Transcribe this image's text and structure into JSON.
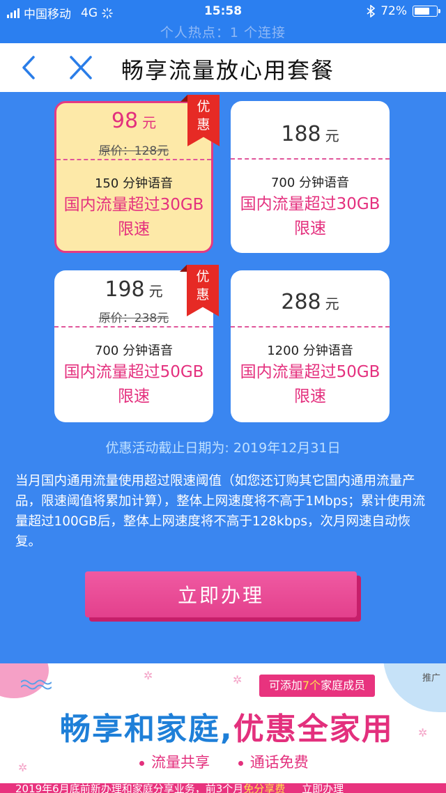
{
  "status_bar": {
    "carrier": "中国移动",
    "network": "4G",
    "time": "15:58",
    "battery": "72%",
    "battery_level": 0.72,
    "hotspot": "个人热点：1 个连接"
  },
  "nav": {
    "back_icon": "chevron-left-icon",
    "close_icon": "close-icon",
    "title": "畅享流量放心用套餐"
  },
  "plans": [
    {
      "price": "98",
      "unit": "元",
      "original": "原价：128元",
      "minutes": "150 分钟语音",
      "data": "国内流量超过30GB",
      "limit": "限速",
      "badge": "优惠",
      "selected": true
    },
    {
      "price": "188",
      "unit": "元",
      "original": "",
      "minutes": "700 分钟语音",
      "data": "国内流量超过30GB",
      "limit": "限速",
      "badge": "",
      "selected": false
    },
    {
      "price": "198",
      "unit": "元",
      "original": "原价：238元",
      "minutes": "700 分钟语音",
      "data": "国内流量超过50GB",
      "limit": "限速",
      "badge": "优惠",
      "selected": false
    },
    {
      "price": "288",
      "unit": "元",
      "original": "",
      "minutes": "1200 分钟语音",
      "data": "国内流量超过50GB",
      "limit": "限速",
      "badge": "",
      "selected": false
    }
  ],
  "badge_chars": [
    "优",
    "惠"
  ],
  "deadline": "优惠活动截止日期为: 2019年12月31日",
  "description": "当月国内通用流量使用超过限速阈值（如您还订购其它国内通用流量产品，限速阈值将累加计算），整体上网速度将不高于1Mbps；累计使用流量超过100GB后，整体上网速度将不高于128kbps，次月网速自动恢复。",
  "apply_button": "立即办理",
  "banner": {
    "tag_prefix": "可添加",
    "tag_number": "7个",
    "tag_suffix": "家庭成员",
    "ad_label": "推广",
    "headline_part1": "畅享和家庭,",
    "headline_part2": "优惠全家用",
    "features": [
      "流量共享",
      "通话免费"
    ],
    "bottom_text_1": "2019年6月底前新办理和家庭分享业务，前3个月",
    "bottom_text_hl": "免分享费",
    "bottom_text_2": "     立即办理"
  },
  "colors": {
    "page_bg": "#3a86f0",
    "accent_pink": "#e3307d",
    "badge_red": "#e62a25",
    "selected_card_bg": "#fde9a8"
  }
}
